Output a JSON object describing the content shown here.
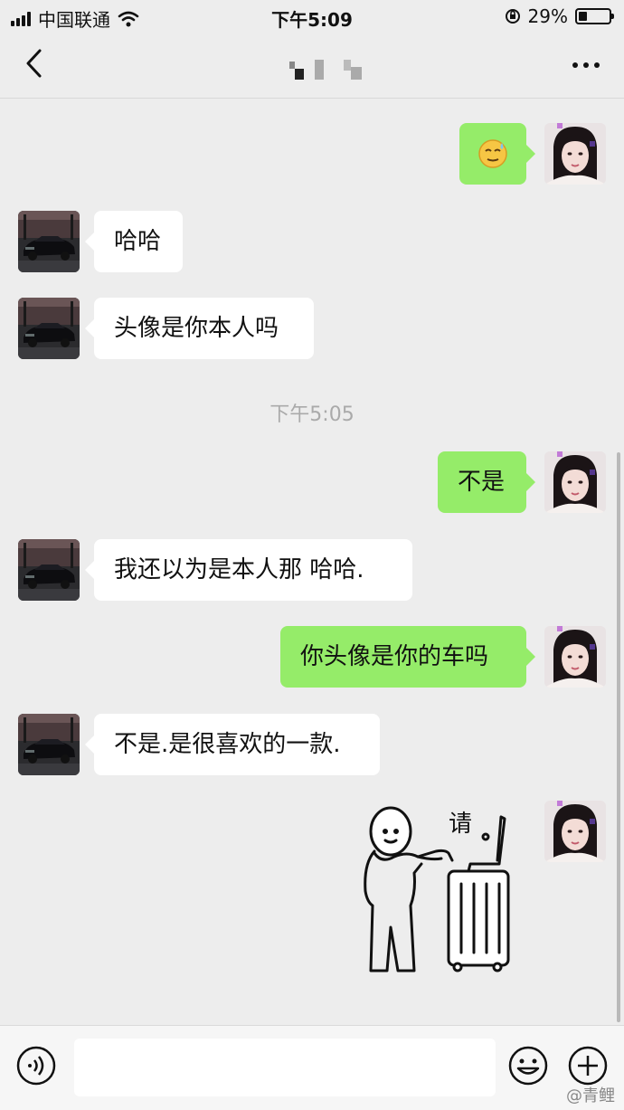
{
  "status_bar": {
    "carrier": "中国联通",
    "time": "下午5:09",
    "battery_percent": "29%",
    "battery_level": 0.29
  },
  "nav": {
    "back_icon": "chevron-left-icon",
    "more_icon": "more-horizontal-icon",
    "title_obscured": true
  },
  "messages": [
    {
      "side": "out",
      "type": "emoji",
      "content": "sweat-smile-emoji"
    },
    {
      "side": "in",
      "type": "text",
      "text": "哈哈"
    },
    {
      "side": "in",
      "type": "text",
      "text": "头像是你本人吗"
    },
    {
      "side": "time",
      "text": "下午5:05"
    },
    {
      "side": "out",
      "type": "text",
      "text": "不是"
    },
    {
      "side": "in",
      "type": "text",
      "text": "我还以为是本人那 哈哈."
    },
    {
      "side": "out",
      "type": "text",
      "text": "你头像是你的车吗"
    },
    {
      "side": "in",
      "type": "text",
      "text": "不是.是很喜欢的一款."
    },
    {
      "side": "out",
      "type": "sticker",
      "text": "请",
      "content": "stick-figure-suitcase-sticker"
    }
  ],
  "input_bar": {
    "voice_icon": "voice-icon",
    "emoji_icon": "emoji-icon",
    "plus_icon": "plus-icon",
    "placeholder": ""
  },
  "watermark": "@青鲤",
  "colors": {
    "background": "#ededed",
    "outgoing_bubble": "#95ec69",
    "incoming_bubble": "#ffffff"
  }
}
